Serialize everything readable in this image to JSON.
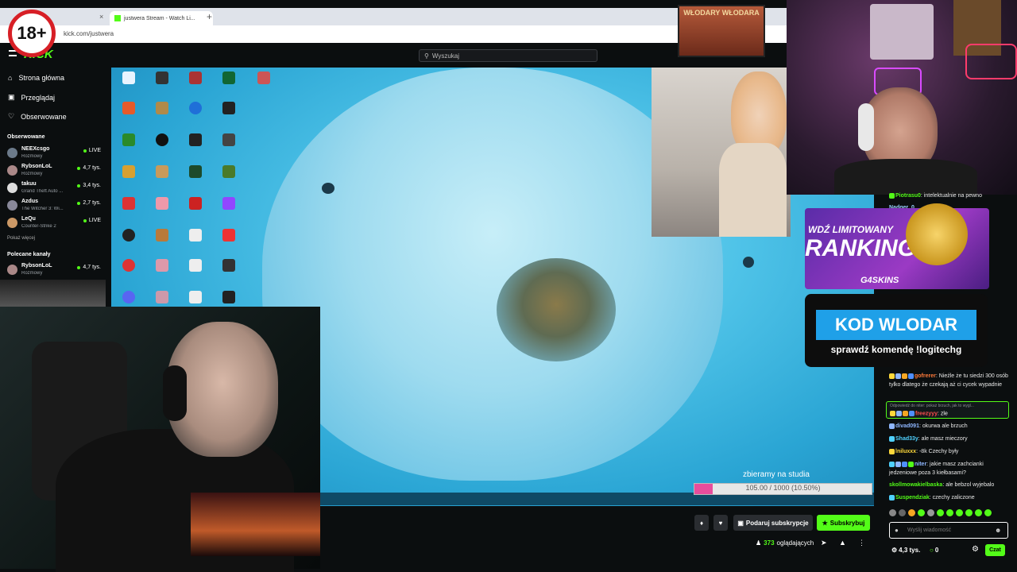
{
  "browser": {
    "tab_title": "justwera Stream - Watch Li...",
    "url": "kick.com/justwera",
    "new_tab_glyph": "+",
    "close_glyph": "×"
  },
  "header": {
    "logo": "KICK",
    "search_placeholder": "Wyszukaj"
  },
  "nav": {
    "home": "Strona główna",
    "browse": "Przeglądaj",
    "following": "Obserwowane"
  },
  "sidebar": {
    "followed_title": "Obserwowane",
    "followed": [
      {
        "name": "NEEXcsgo",
        "game": "Rozmowy",
        "viewers": "LIVE"
      },
      {
        "name": "RybsonLoL",
        "game": "Rozmowy",
        "viewers": "4,7 tys."
      },
      {
        "name": "takuu",
        "game": "Grand Theft Auto ...",
        "viewers": "3,4 tys."
      },
      {
        "name": "Azdus",
        "game": "The Witcher 3: Wi...",
        "viewers": "2,7 tys."
      },
      {
        "name": "LeQu",
        "game": "Counter-Strike 2",
        "viewers": "LIVE"
      }
    ],
    "show_more": "Pokaż więcej",
    "recommended_title": "Polecane kanały",
    "recommended": [
      {
        "name": "RybsonLoL",
        "game": "Rozmowy",
        "viewers": "4,7 tys."
      }
    ]
  },
  "overlay": {
    "age_badge": "18+",
    "wlodary_banner": "WŁODARY WŁODARA",
    "donation_label": "zbieramy na studia",
    "donation_text": "105.00 / 1000 (10.50%)",
    "donation_progress": 0.105
  },
  "promo": {
    "line1": "WDŹ LIMITOWANY",
    "line2": "RANKING!",
    "brand": "G4SKINS",
    "code": "KOD WLODAR",
    "sub": "sprawdź komendę !logitechg"
  },
  "chat": {
    "partial": [
      {
        "user": "Piotrasu0",
        "text": ": intelektualnie na pewno",
        "color": "#53fc18"
      },
      {
        "user": "Nadger_0",
        "text": "",
        "color": "#9ad3ff"
      }
    ],
    "messages": [
      {
        "user": "gofrerer",
        "text": ": Nieźle że tu siedzi 300 osób tylko dlatego że czekają aż ci cycek wypadnie",
        "color": "#ff7a3a"
      },
      {
        "user": "divad091",
        "text": ": okurwa ale brzuch",
        "color": "#8fb7ff"
      },
      {
        "user": "Shad33y",
        "text": ": ale masz mieczory",
        "color": "#4fd1ff"
      },
      {
        "user": "lniluxxx",
        "text": ": -8k Czechy były",
        "color": "#ffd93b"
      },
      {
        "user": "niter",
        "text": ": jakie masz zachcianki jedzeniowe poza 3 kiełbasami?",
        "color": "#8fb7ff"
      },
      {
        "user": "skollmowakielbaska",
        "text": ": ale bebzol wyjebalo",
        "color": "#53fc18"
      },
      {
        "user": "Suspendziak",
        "text": ": czechy zaliczone",
        "color": "#53fc18"
      }
    ],
    "reply_context": "Odpowiedź do niter: pokaż brzuch, jak to wygl...",
    "reply_user": "freezyyy",
    "reply_text": ": zle",
    "reply_user_color": "#ff4f4f",
    "input_placeholder": "Wyślij wiadomość",
    "send_button": "Czat",
    "stat_followers": "4,3 tys.",
    "stat_points": "0"
  },
  "actions": {
    "gift_sub": "Podaruj subskrypcje",
    "subscribe": "Subskrybuj",
    "viewers_count": "373",
    "viewers_label": "oglądających"
  },
  "colors": {
    "accent": "#53fc18",
    "bg": "#0b0e0f",
    "promo_blue": "#1fa0e8"
  }
}
